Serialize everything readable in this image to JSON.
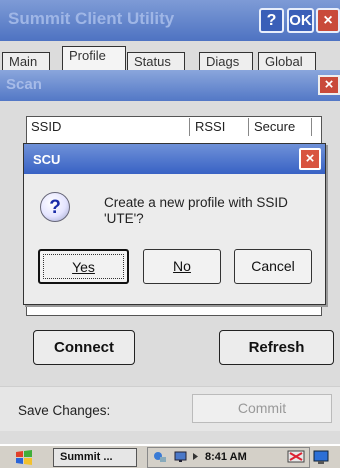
{
  "window": {
    "title": "Summit Client Utility",
    "help_label": "?",
    "ok_label": "OK",
    "close_label": "×"
  },
  "tabs": [
    {
      "label": "Main"
    },
    {
      "label": "Profile",
      "active": true
    },
    {
      "label": "Status"
    },
    {
      "label": "Diags"
    },
    {
      "label": "Global"
    }
  ],
  "scan": {
    "title": "Scan",
    "close_label": "×",
    "columns": [
      "SSID",
      "RSSI",
      "Secure"
    ]
  },
  "dialog": {
    "title": "SCU",
    "close_label": "×",
    "icon": "question-icon",
    "message": "Create a new profile with SSID 'UTE'?",
    "buttons": {
      "yes": "Yes",
      "no": "No",
      "cancel": "Cancel"
    }
  },
  "actions": {
    "connect": "Connect",
    "refresh": "Refresh"
  },
  "save": {
    "label": "Save Changes:",
    "commit": "Commit"
  },
  "taskbar": {
    "app_label": "Summit ...",
    "clock": "8:41 AM"
  },
  "colors": {
    "titlebar": "#4e73c2",
    "close_red": "#c94a3a",
    "icon_blue": "#1a2ca8"
  }
}
